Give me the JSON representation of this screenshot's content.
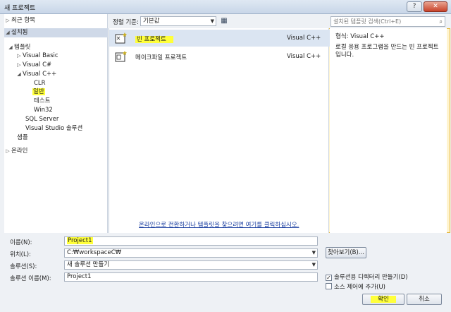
{
  "window": {
    "title": "새 프로젝트",
    "help_label": "?",
    "close_label": "✕"
  },
  "nav": {
    "recent": "최근 항목",
    "installed": "설치됨",
    "templates": "템플릿",
    "visual_basic": "Visual Basic",
    "visual_csharp": "Visual C#",
    "visual_cpp": "Visual C++",
    "clr": "CLR",
    "general": "일반",
    "test": "테스트",
    "win32": "Win32",
    "sql_server": "SQL Server",
    "vs_solution": "Visual Studio 솔루션",
    "samples": "샘플",
    "online": "온라인"
  },
  "toolbar": {
    "sort_label": "정렬 기준:",
    "sort_value": "기본값",
    "search_placeholder": "설치된 템플릿 검색(Ctrl+E)"
  },
  "templates": [
    {
      "name": "빈 프로젝트",
      "lang": "Visual C++"
    },
    {
      "name": "메이크파일 프로젝트",
      "lang": "Visual C++"
    }
  ],
  "online_link": "온라인으로 전환하거나 템플릿을 찾으려면 여기를 클릭하십시오.",
  "details": {
    "type": "형식:  Visual C++",
    "description": "로컬 응용 프로그램을 만드는 빈 프로젝트입니다."
  },
  "form": {
    "name_label": "이름(N):",
    "name_value": "Project1",
    "location_label": "위치(L):",
    "location_value": "C:₩workspaceC₩",
    "browse_label": "찾아보기(B)...",
    "solution_label": "솔루션(S):",
    "solution_value": "새 솔루션 만들기",
    "solution_name_label": "솔루션 이름(M):",
    "solution_name_value": "Project1",
    "create_dir_label": "솔루션용 디렉터리 만들기(D)",
    "create_dir_checked": true,
    "source_control_label": "소스 제어에 추가(U)",
    "ok_label": "확인",
    "cancel_label": "취소"
  }
}
